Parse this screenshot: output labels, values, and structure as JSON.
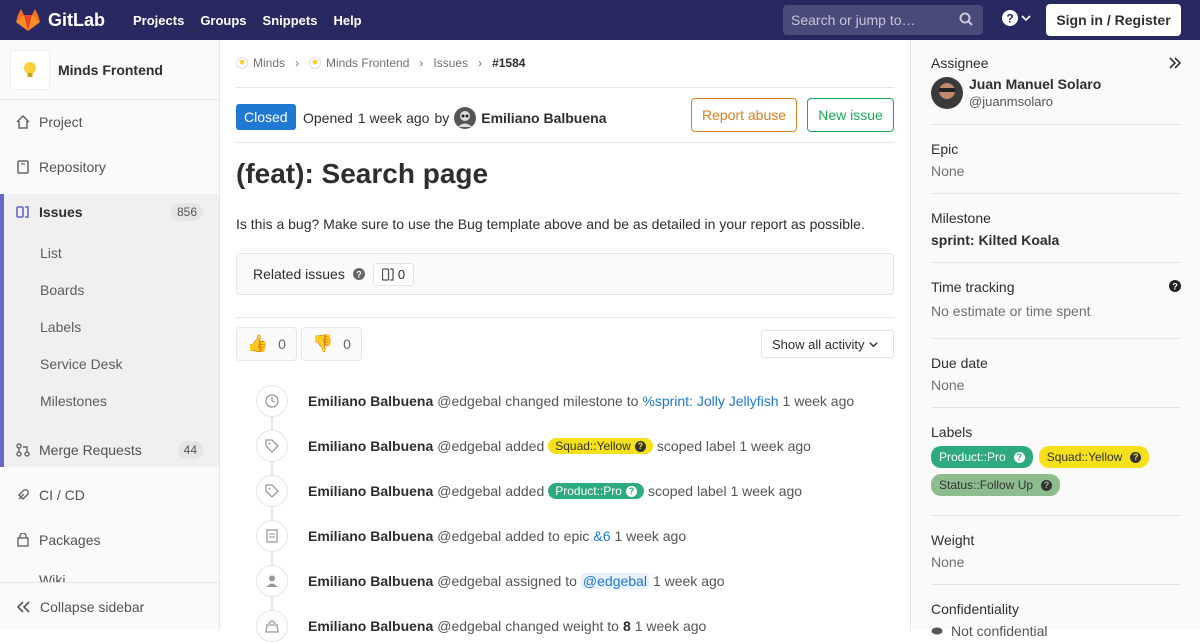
{
  "topbar": {
    "brand": "GitLab",
    "nav": [
      "Projects",
      "Groups",
      "Snippets",
      "Help"
    ],
    "search_placeholder": "Search or jump to…",
    "signin": "Sign in / Register"
  },
  "sidebar": {
    "project_name": "Minds Frontend",
    "items": [
      {
        "label": "Project"
      },
      {
        "label": "Repository"
      },
      {
        "label": "Issues",
        "badge": "856"
      },
      {
        "label": "Merge Requests",
        "badge": "44"
      },
      {
        "label": "CI / CD"
      },
      {
        "label": "Packages"
      },
      {
        "label": "Wiki"
      }
    ],
    "sub_items": [
      "List",
      "Boards",
      "Labels",
      "Service Desk",
      "Milestones"
    ],
    "collapse": "Collapse sidebar"
  },
  "breadcrumb": [
    "Minds",
    "Minds Frontend",
    "Issues",
    "#1584"
  ],
  "issue": {
    "status": "Closed",
    "opened": "Opened",
    "time": "1 week ago",
    "by": "by",
    "author": "Emiliano Balbuena",
    "report_abuse": "Report abuse",
    "new_issue": "New issue",
    "title": "(feat): Search page",
    "description": "Is this a bug? Make sure to use the Bug template above and be as detailed in your report as possible.",
    "related_label": "Related issues",
    "related_count": "0",
    "thumbs_up": "0",
    "thumbs_down": "0",
    "activity_filter": "Show all activity"
  },
  "notes": [
    {
      "author": "Emiliano Balbuena",
      "handle": "@edgebal",
      "pre": "changed milestone to",
      "link": "%sprint: Jolly Jellyfish",
      "post": "1 week ago"
    },
    {
      "author": "Emiliano Balbuena",
      "handle": "@edgebal",
      "pre": "added",
      "label": "Squad::Yellow",
      "post": "scoped label 1 week ago"
    },
    {
      "author": "Emiliano Balbuena",
      "handle": "@edgebal",
      "pre": "added",
      "label": "Product::Pro",
      "post": "scoped label 1 week ago"
    },
    {
      "author": "Emiliano Balbuena",
      "handle": "@edgebal",
      "pre": "added to epic",
      "link": "&6",
      "post": "1 week ago"
    },
    {
      "author": "Emiliano Balbuena",
      "handle": "@edgebal",
      "pre": "assigned to",
      "link": "@edgebal",
      "post": "1 week ago"
    },
    {
      "author": "Emiliano Balbuena",
      "handle": "@edgebal",
      "pre": "changed weight to",
      "link": "8",
      "post": "1 week ago"
    }
  ],
  "right": {
    "assignee_label": "Assignee",
    "assignee_name": "Juan Manuel Solaro",
    "assignee_handle": "@juanmsolaro",
    "epic_label": "Epic",
    "epic_value": "None",
    "milestone_label": "Milestone",
    "milestone_value": "sprint: Kilted Koala",
    "time_label": "Time tracking",
    "time_value": "No estimate or time spent",
    "due_label": "Due date",
    "due_value": "None",
    "labels_label": "Labels",
    "labels": [
      "Product::Pro",
      "Squad::Yellow",
      "Status::Follow Up"
    ],
    "weight_label": "Weight",
    "weight_value": "None",
    "conf_label": "Confidentiality",
    "conf_value": "Not confidential"
  },
  "colors": {
    "topbar": "#292961",
    "accent": "#6666c4",
    "closed": "#1f78d1",
    "orange": "#db7f1f",
    "green": "#1aaa55"
  }
}
